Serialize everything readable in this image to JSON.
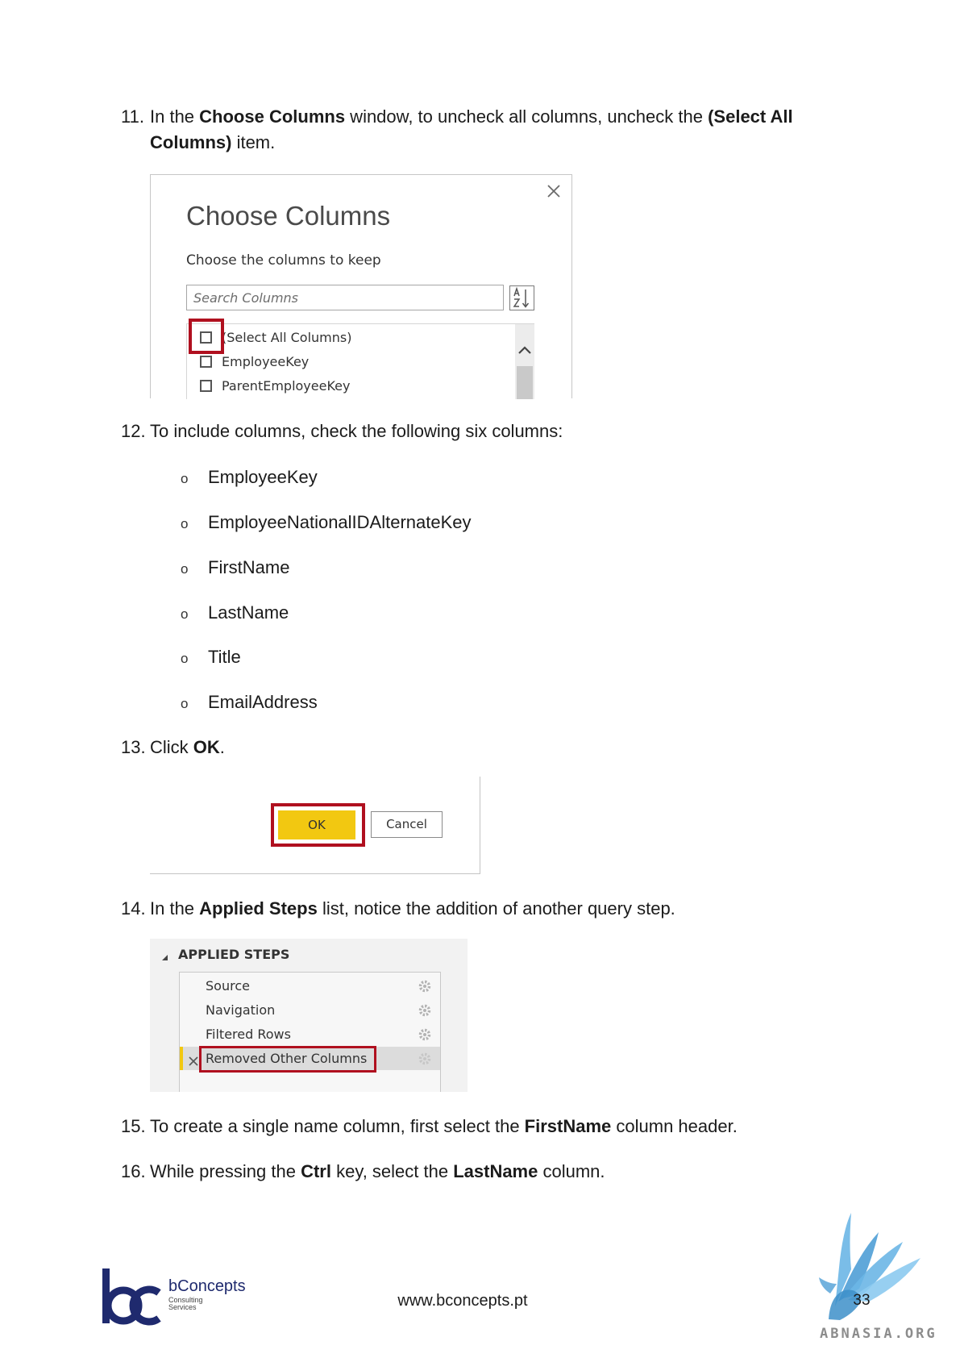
{
  "step11": {
    "number": "11.",
    "text_a": "In the ",
    "bold_a": "Choose Columns",
    "text_b": " window, to uncheck all columns, uncheck the ",
    "bold_b": "(Select All Columns)",
    "text_c": " item."
  },
  "choose_columns_dialog": {
    "title": "Choose Columns",
    "subtitle": "Choose the columns to keep",
    "search_placeholder": "Search Columns",
    "items": [
      {
        "label": "(Select All Columns)",
        "checked": false,
        "highlighted": true
      },
      {
        "label": "EmployeeKey",
        "checked": false
      },
      {
        "label": "ParentEmployeeKey",
        "checked": false
      }
    ]
  },
  "step12": {
    "number": "12.",
    "text": "To include columns, check the following six columns:"
  },
  "list_bullet": "o",
  "columns_to_check": [
    "EmployeeKey",
    "EmployeeNationalIDAlternateKey",
    "FirstName",
    "LastName",
    "Title",
    "EmailAddress"
  ],
  "step13": {
    "number": "13.",
    "text_a": "Click ",
    "bold_a": "OK",
    "text_b": "."
  },
  "dialog_buttons": {
    "ok_label": "OK",
    "cancel_label": "Cancel"
  },
  "step14": {
    "number": "14.",
    "text_a": "In the ",
    "bold_a": "Applied Steps",
    "text_b": " list, notice the addition of another query step."
  },
  "applied_steps": {
    "header": "APPLIED STEPS",
    "items": [
      {
        "label": "Source",
        "selected": false
      },
      {
        "label": "Navigation",
        "selected": false
      },
      {
        "label": "Filtered Rows",
        "selected": false
      },
      {
        "label": "Removed Other Columns",
        "selected": true
      }
    ]
  },
  "step15": {
    "number": "15.",
    "text_a": "To create a single name column, first select the ",
    "bold_a": "FirstName",
    "text_b": " column header."
  },
  "step16": {
    "number": "16.",
    "text_a": "While pressing the ",
    "bold_a": "Ctrl",
    "text_b": " key, select the ",
    "bold_b": "LastName",
    "text_c": " column."
  },
  "footer": {
    "logo_letters": "bc",
    "brand": "bConcepts",
    "tagline_1": "Consulting",
    "tagline_2": "Services",
    "website": "www.bconcepts.pt",
    "page_number": "33",
    "watermark": "ABNASIA.ORG"
  },
  "icons": {
    "dialog_close": "close-icon",
    "sort": "sort-az-icon",
    "scroll_up": "chevron-up-icon",
    "collapse": "collapse-triangle-icon",
    "step_settings": "gear-icon",
    "step_delete": "delete-step-icon"
  },
  "colors": {
    "highlight_red": "#B0101F",
    "ok_yellow": "#F2C811",
    "brand_navy": "#1f2a6e",
    "watermark_blue": "#6cb6e6"
  }
}
